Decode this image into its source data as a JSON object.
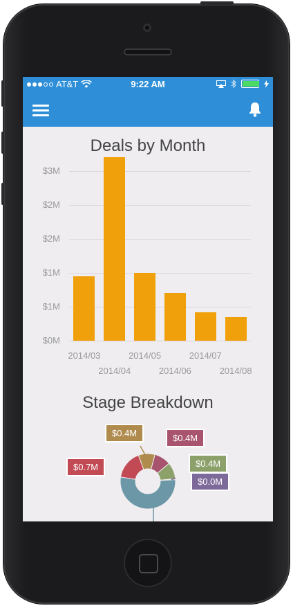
{
  "status_bar": {
    "carrier": "AT&T",
    "time": "9:22 AM",
    "signal_bars_filled": 3,
    "signal_bars_total": 5,
    "battery_level": 1.0
  },
  "nav": {
    "menu_icon": "hamburger-icon",
    "notifications_icon": "bell-icon",
    "bar_color": "#2e8fd8"
  },
  "deals_chart": {
    "chart_data": {
      "type": "bar",
      "title": "Deals by Month",
      "categories": [
        "2014/03",
        "2014/04",
        "2014/05",
        "2014/06",
        "2014/07",
        "2014/08"
      ],
      "values": [
        0.95,
        2.7,
        1.0,
        0.7,
        0.42,
        0.35
      ],
      "ylim": [
        0,
        2.5
      ],
      "y_ticks": [
        "$0M",
        "$1M",
        "$1M",
        "$2M",
        "$2M",
        "$3M"
      ],
      "color": "#f0a00a",
      "grid": true
    }
  },
  "stage_chart": {
    "chart_data": {
      "type": "pie",
      "title": "Stage Breakdown",
      "slices": [
        {
          "label": "$0.4M",
          "value": 0.4,
          "color": "#b08b4e"
        },
        {
          "label": "$0.4M",
          "value": 0.4,
          "color": "#a8546e"
        },
        {
          "label": "$0.4M",
          "value": 0.4,
          "color": "#8ca06a"
        },
        {
          "label": "$0.0M",
          "value": 0.02,
          "color": "#7d6a9a"
        },
        {
          "label": "",
          "value": 2.2,
          "color": "#6b97a6"
        },
        {
          "label": "$0.7M",
          "value": 0.7,
          "color": "#c24a55"
        }
      ]
    }
  }
}
